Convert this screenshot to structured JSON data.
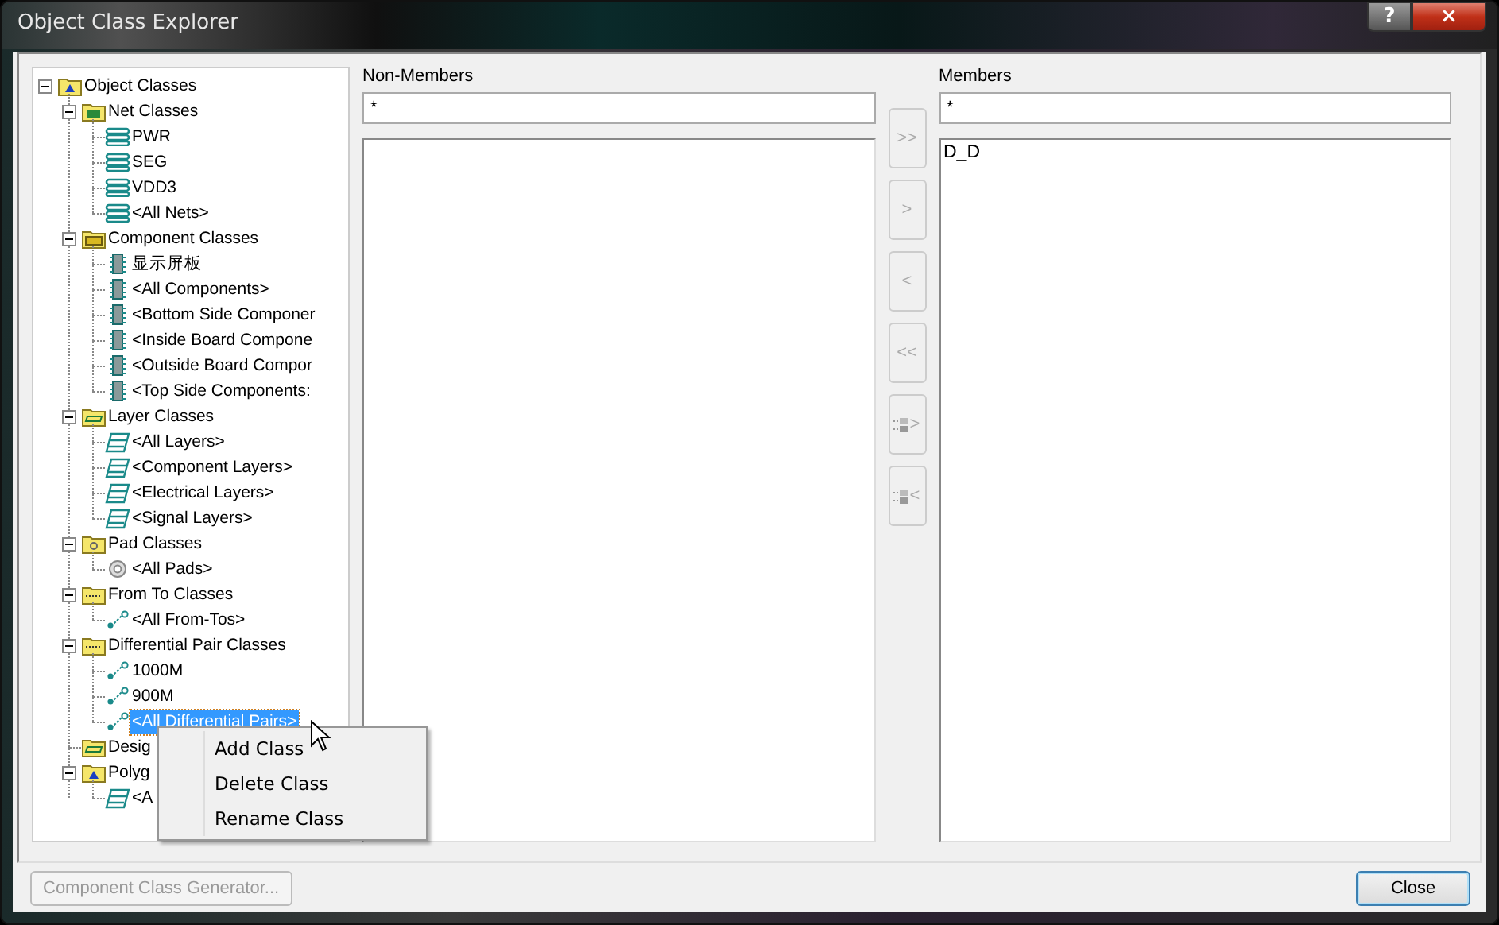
{
  "window": {
    "title": "Object Class Explorer",
    "help_button": "?",
    "close_button": "×"
  },
  "tree": [
    {
      "label": "Object Classes",
      "kind": "root",
      "expanded": true,
      "selected": false,
      "children": [
        {
          "label": "Net Classes",
          "kind": "net-folder",
          "expanded": true,
          "selected": false,
          "children": [
            {
              "label": "PWR",
              "kind": "net",
              "selected": false
            },
            {
              "label": "SEG",
              "kind": "net",
              "selected": false
            },
            {
              "label": "VDD3",
              "kind": "net",
              "selected": false
            },
            {
              "label": "<All Nets>",
              "kind": "net",
              "selected": false
            }
          ]
        },
        {
          "label": "Component Classes",
          "kind": "component-folder",
          "expanded": true,
          "selected": false,
          "children": [
            {
              "label": "显示屏板",
              "kind": "component",
              "selected": false
            },
            {
              "label": "<All Components>",
              "kind": "component",
              "selected": false
            },
            {
              "label": "<Bottom Side Componer",
              "kind": "component",
              "selected": false
            },
            {
              "label": "<Inside Board Compone",
              "kind": "component",
              "selected": false
            },
            {
              "label": "<Outside Board Compor",
              "kind": "component",
              "selected": false
            },
            {
              "label": "<Top Side Components:",
              "kind": "component",
              "selected": false
            }
          ]
        },
        {
          "label": "Layer Classes",
          "kind": "layer-folder",
          "expanded": true,
          "selected": false,
          "children": [
            {
              "label": "<All Layers>",
              "kind": "layer",
              "selected": false
            },
            {
              "label": "<Component Layers>",
              "kind": "layer",
              "selected": false
            },
            {
              "label": "<Electrical Layers>",
              "kind": "layer",
              "selected": false
            },
            {
              "label": "<Signal Layers>",
              "kind": "layer",
              "selected": false
            }
          ]
        },
        {
          "label": "Pad Classes",
          "kind": "pad-folder",
          "expanded": true,
          "selected": false,
          "children": [
            {
              "label": "<All Pads>",
              "kind": "pad",
              "selected": false
            }
          ]
        },
        {
          "label": "From To Classes",
          "kind": "link-folder",
          "expanded": true,
          "selected": false,
          "children": [
            {
              "label": "<All From-Tos>",
              "kind": "link",
              "selected": false
            }
          ]
        },
        {
          "label": "Differential Pair Classes",
          "kind": "link-folder",
          "expanded": true,
          "selected": false,
          "children": [
            {
              "label": "1000M",
              "kind": "link",
              "selected": false
            },
            {
              "label": "900M",
              "kind": "link",
              "selected": false
            },
            {
              "label": "<All Differential Pairs>",
              "kind": "link",
              "selected": true
            }
          ]
        },
        {
          "label": "Desig",
          "kind": "layer-folder",
          "selected": false
        },
        {
          "label": "Polyg",
          "kind": "root",
          "expanded": true,
          "selected": false,
          "children": [
            {
              "label": "<A",
              "kind": "layer",
              "selected": false
            }
          ]
        }
      ]
    }
  ],
  "non_members": {
    "label": "Non-Members",
    "filter": "*"
  },
  "members": {
    "label": "Members",
    "filter": "*",
    "items": [
      "D_D"
    ]
  },
  "transfer_buttons": [
    {
      "label": ">>",
      "kind": "text"
    },
    {
      "label": ">",
      "kind": "text"
    },
    {
      "label": "<",
      "kind": "text"
    },
    {
      "label": "<<",
      "kind": "text"
    },
    {
      "label": ">",
      "kind": "icon"
    },
    {
      "label": "<",
      "kind": "icon"
    }
  ],
  "context_menu": [
    "Add Class",
    "Delete Class",
    "Rename Class"
  ],
  "footer": {
    "generator_button": "Component Class Generator...",
    "generator_disabled": true,
    "close_button": "Close"
  }
}
